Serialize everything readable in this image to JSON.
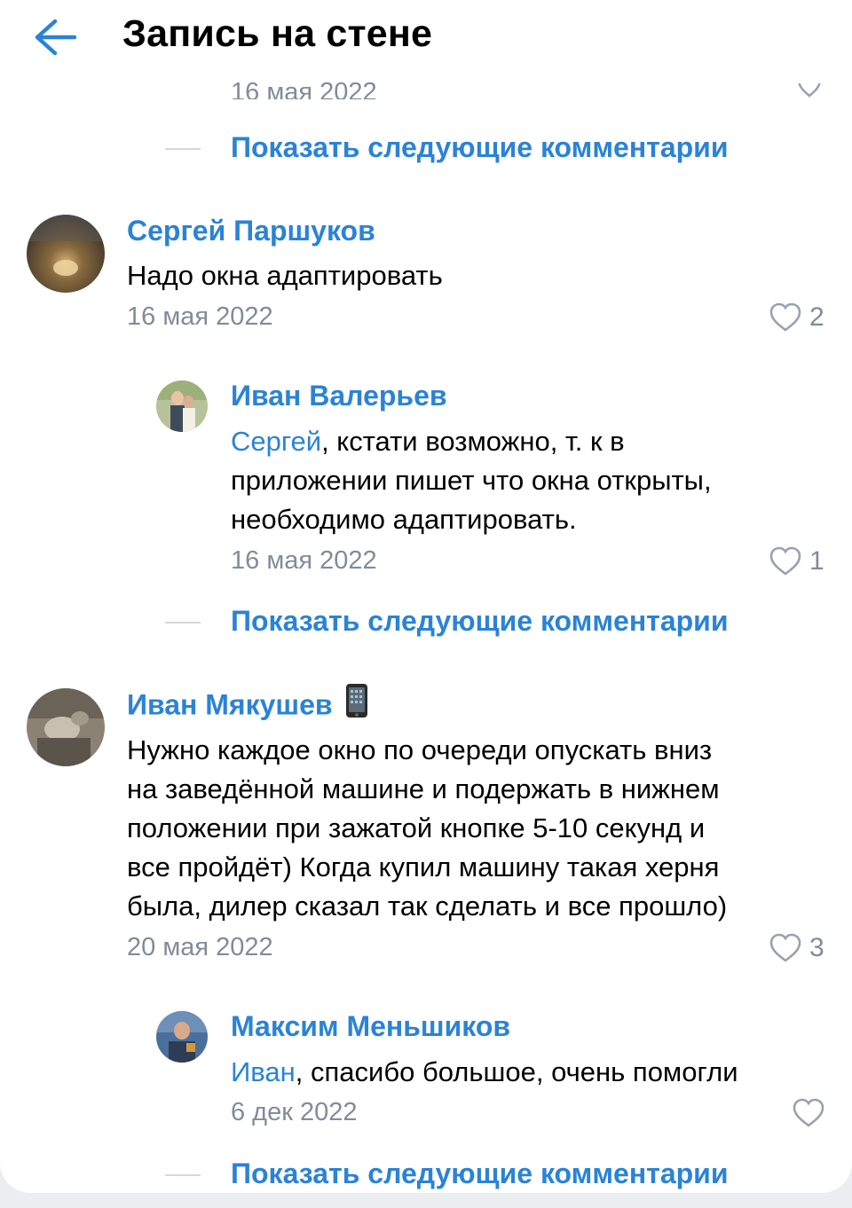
{
  "header": {
    "title": "Запись на стене"
  },
  "top_partial": {
    "date": "16 мая 2022"
  },
  "more_link": "Показать следующие комментарии",
  "comments": [
    {
      "author": "Сергей Паршуков",
      "text": "Надо окна адаптировать",
      "date": "16 мая 2022",
      "likes": "2"
    },
    {
      "author": "Иван Валерьев",
      "mention": "Сергей",
      "text_line1": ", кстати возможно, т. к в",
      "text_line2": "приложении пишет что окна открыты,",
      "text_line3": "необходимо адаптировать.",
      "date": "16 мая 2022",
      "likes": "1"
    },
    {
      "author": "Иван Мякушев",
      "author_emoji": "mobile-phone-emoji",
      "lines": [
        "Нужно каждое окно по очереди опускать вниз",
        "на заведённой машине и подержать в нижнем",
        "положении при зажатой кнопке 5-10 секунд и",
        "все пройдёт) Когда купил машину такая херня",
        "была, дилер сказал так сделать и все прошло)"
      ],
      "date": "20 мая 2022",
      "likes": "3"
    },
    {
      "author": "Максим Меньшиков",
      "mention": "Иван",
      "text": ", спасибо большое, очень помогли",
      "date": "6 дек 2022",
      "likes": ""
    }
  ],
  "icons": {
    "back": "arrow-left-icon",
    "like": "heart-outline-icon"
  },
  "colors": {
    "accent": "#2a83d6",
    "secondary_text": "#818c99",
    "text": "#000000",
    "background": "#ffffff"
  }
}
